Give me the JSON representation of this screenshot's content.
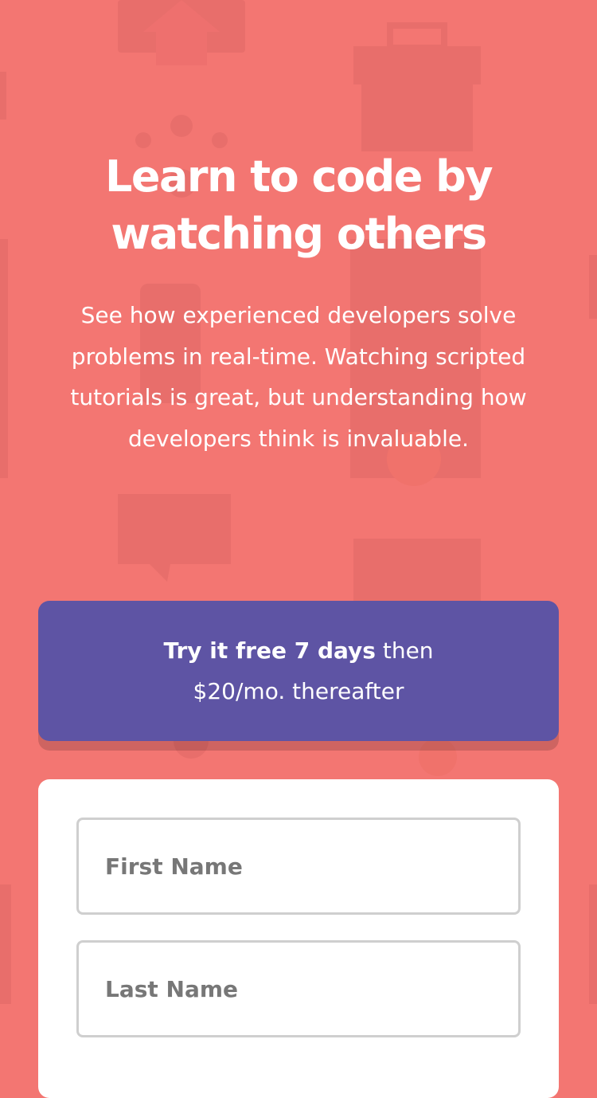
{
  "theme": {
    "background": "#f37672",
    "promo_color": "#5e54a4",
    "card_color": "#ffffff"
  },
  "hero": {
    "title_line1": "Learn to code by",
    "title_line2": "watching others",
    "description": "See how experienced developers solve problems in real-time. Watching scripted tutorials is great, but understanding how developers think is invaluable."
  },
  "promo": {
    "strong_text": "Try it free 7 days",
    "text_after": " then",
    "line2": "$20/mo. thereafter"
  },
  "form": {
    "first_name": {
      "placeholder": "First Name",
      "value": ""
    },
    "last_name": {
      "placeholder": "Last Name",
      "value": ""
    }
  },
  "background_icons": [
    "house-icon",
    "toolbox-icon",
    "network-icon",
    "phone-icon",
    "document-icon",
    "chat-pencil-icon",
    "browser-window-icon",
    "gear-icon"
  ]
}
